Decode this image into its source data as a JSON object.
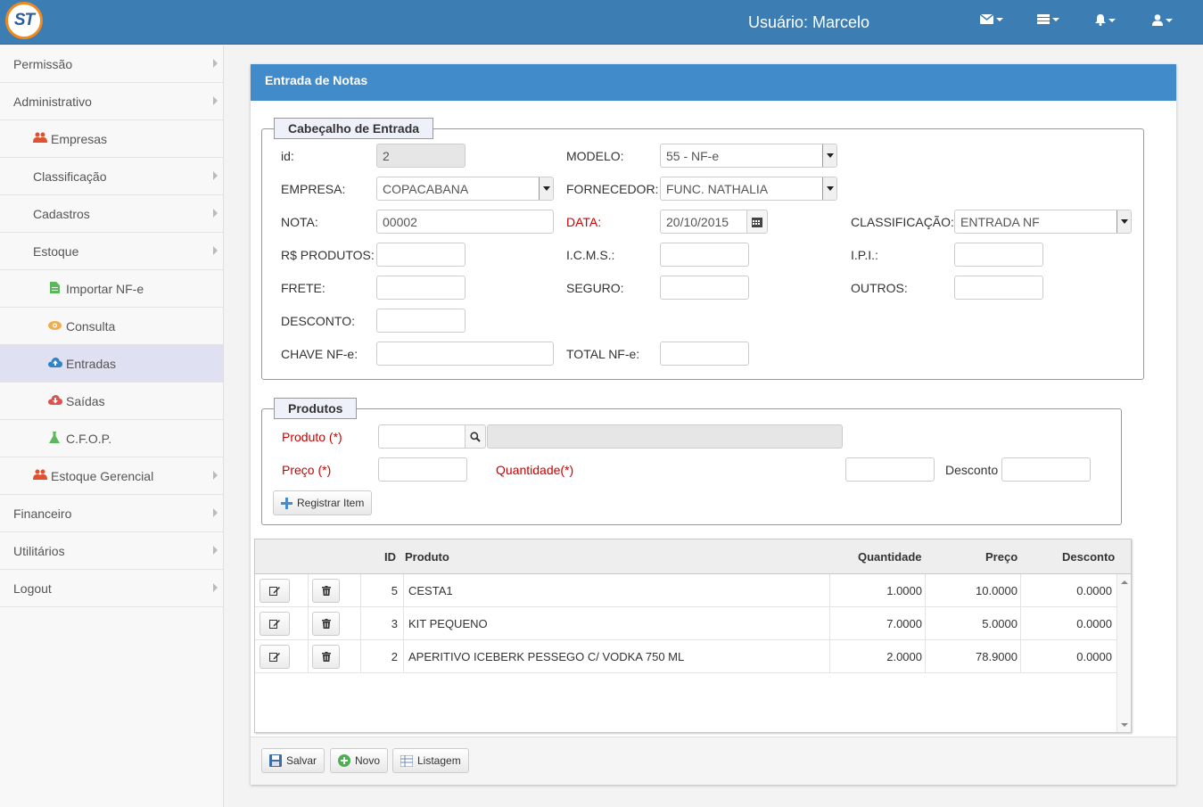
{
  "header": {
    "logo_text": "ST",
    "user_label": "Usuário: Marcelo",
    "icons": [
      "envelope-icon",
      "list-icon",
      "bell-icon",
      "user-icon"
    ]
  },
  "sidebar": {
    "items": [
      {
        "label": "Permissão",
        "level": 0,
        "arrow": true
      },
      {
        "label": "Administrativo",
        "level": 0,
        "arrow": true
      },
      {
        "label": "Empresas",
        "level": 1,
        "icon": "users-icon",
        "arrow": false
      },
      {
        "label": "Classificação",
        "level": 1,
        "arrow": true
      },
      {
        "label": "Cadastros",
        "level": 1,
        "arrow": true
      },
      {
        "label": "Estoque",
        "level": 1,
        "arrow": true
      },
      {
        "label": "Importar NF-e",
        "level": 2,
        "icon": "file-icon",
        "arrow": false
      },
      {
        "label": "Consulta",
        "level": 2,
        "icon": "eye-icon",
        "arrow": false
      },
      {
        "label": "Entradas",
        "level": 2,
        "icon": "cloud-upload-icon",
        "arrow": false,
        "active": true
      },
      {
        "label": "Saídas",
        "level": 2,
        "icon": "cloud-download-icon",
        "arrow": false
      },
      {
        "label": "C.F.O.P.",
        "level": 2,
        "icon": "flask-icon",
        "arrow": false
      },
      {
        "label": "Estoque Gerencial",
        "level": 1,
        "icon": "users-icon",
        "arrow": true
      },
      {
        "label": "Financeiro",
        "level": 0,
        "arrow": true
      },
      {
        "label": "Utilitários",
        "level": 0,
        "arrow": true
      },
      {
        "label": "Logout",
        "level": 0,
        "arrow": true
      }
    ]
  },
  "panel": {
    "title": "Entrada de Notas"
  },
  "cabecalho": {
    "legend": "Cabeçalho de Entrada",
    "id_label": "id:",
    "id_value": "2",
    "modelo_label": "MODELO:",
    "modelo_value": "55 - NF-e",
    "empresa_label": "EMPRESA:",
    "empresa_value": "COPACABANA",
    "fornecedor_label": "FORNECEDOR:",
    "fornecedor_value": "FUNC. NATHALIA",
    "nota_label": "NOTA:",
    "nota_value": "00002",
    "data_label": "DATA:",
    "data_value": "20/10/2015",
    "classificacao_label": "CLASSIFICAÇÃO:",
    "classificacao_value": "ENTRADA NF",
    "produtos_label": "R$ PRODUTOS:",
    "produtos_value": "",
    "icms_label": "I.C.M.S.:",
    "icms_value": "",
    "ipi_label": "I.P.I.:",
    "ipi_value": "",
    "frete_label": "FRETE:",
    "frete_value": "",
    "seguro_label": "SEGURO:",
    "seguro_value": "",
    "outros_label": "OUTROS:",
    "outros_value": "",
    "desconto_label": "DESCONTO:",
    "desconto_value": "",
    "chave_label": "CHAVE NF-e:",
    "chave_value": "",
    "total_label": "TOTAL NF-e:",
    "total_value": ""
  },
  "produtos": {
    "legend": "Produtos",
    "produto_label": "Produto (*)",
    "preco_label": "Preço (*)",
    "quantidade_label": "Quantidade(*)",
    "desconto_label": "Desconto",
    "registrar_label": "Registrar Item"
  },
  "grid": {
    "columns": {
      "id": "ID",
      "produto": "Produto",
      "quantidade": "Quantidade",
      "preco": "Preço",
      "desconto": "Desconto"
    },
    "rows": [
      {
        "id": "5",
        "produto": "CESTA1",
        "quantidade": "1.0000",
        "preco": "10.0000",
        "desconto": "0.0000"
      },
      {
        "id": "3",
        "produto": "KIT PEQUENO",
        "quantidade": "7.0000",
        "preco": "5.0000",
        "desconto": "0.0000"
      },
      {
        "id": "2",
        "produto": "APERITIVO ICEBERK PESSEGO C/ VODKA 750 ML",
        "quantidade": "2.0000",
        "preco": "78.9000",
        "desconto": "0.0000"
      }
    ]
  },
  "footer": {
    "salvar_label": "Salvar",
    "novo_label": "Novo",
    "listagem_label": "Listagem"
  }
}
